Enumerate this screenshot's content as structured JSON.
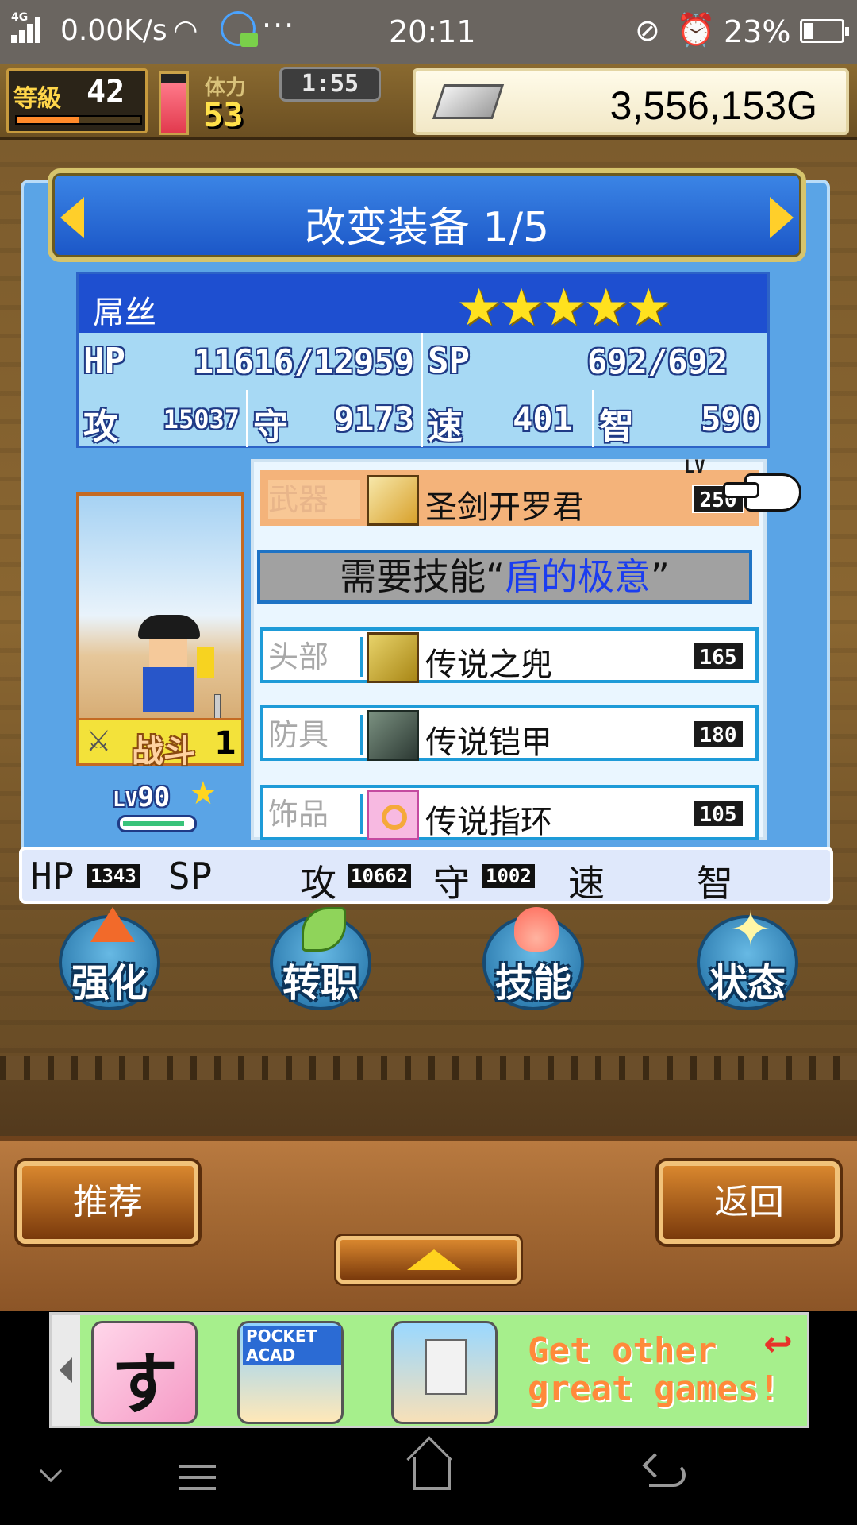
{
  "status_bar": {
    "network_type": "4G",
    "net_speed": "0.00K/s",
    "overflow": "···",
    "time": "20:11",
    "battery_percent": "23%",
    "battery_level": 0.23
  },
  "hud": {
    "level_label": "等級",
    "level": "42",
    "level_progress": 0.5,
    "stamina_label": "体力",
    "stamina": "53",
    "stamina_gauge": 0.85,
    "timer": "1:55",
    "money": "3,556,153G"
  },
  "panel": {
    "title": "改变装备 1/5",
    "character": {
      "name": "屌丝",
      "stars": "★★★★★",
      "star_count": 5,
      "hp_label": "HP",
      "hp": "11616/12959",
      "sp_label": "SP",
      "sp": "692/692",
      "atk_label": "攻",
      "atk": "15037",
      "def_label": "守",
      "def": "9173",
      "spd_label": "速",
      "spd": "401",
      "int_label": "智",
      "int": "590",
      "role_label": "战斗",
      "role_count": "1",
      "lv_prefix": "LV",
      "lv": "90",
      "hp_bar": 0.9
    },
    "equipment": {
      "lv_tag": "LV",
      "weapon": {
        "category": "武器",
        "name": "圣剑开罗君",
        "level": "250",
        "icon": "sword-icon"
      },
      "skill_requirement_prefix": "需要技能“",
      "skill_requirement_name": "盾的极意",
      "skill_requirement_suffix": "”",
      "head": {
        "category": "头部",
        "name": "传说之兜",
        "level": "165",
        "icon": "helmet-icon"
      },
      "armor": {
        "category": "防具",
        "name": "传说铠甲",
        "level": "180",
        "icon": "armor-icon"
      },
      "accessory": {
        "category": "饰品",
        "name": "传说指环",
        "level": "105",
        "icon": "ring-icon"
      }
    },
    "preview": {
      "hp_label": "HP",
      "hp": "1343",
      "sp_label": "SP",
      "atk_label": "攻",
      "atk": "10662",
      "def_label": "守",
      "def": "1002",
      "spd_label": "速",
      "int_label": "智"
    }
  },
  "menu": {
    "enhance": "强化",
    "job_change": "转职",
    "skills": "技能",
    "status": "状态"
  },
  "bottom": {
    "recommend": "推荐",
    "back": "返回"
  },
  "ad": {
    "game1_text": "すし",
    "game2_text": "POCKET ACAD",
    "promo_line1": "Get other",
    "promo_line2": "great games!"
  },
  "colors": {
    "panel_blue": "#5aa4e6",
    "title_blue": "#1b56c7",
    "weapon_highlight": "#f4b37a",
    "skill_name": "#1b3df0",
    "star_yellow": "#ffe11e"
  }
}
